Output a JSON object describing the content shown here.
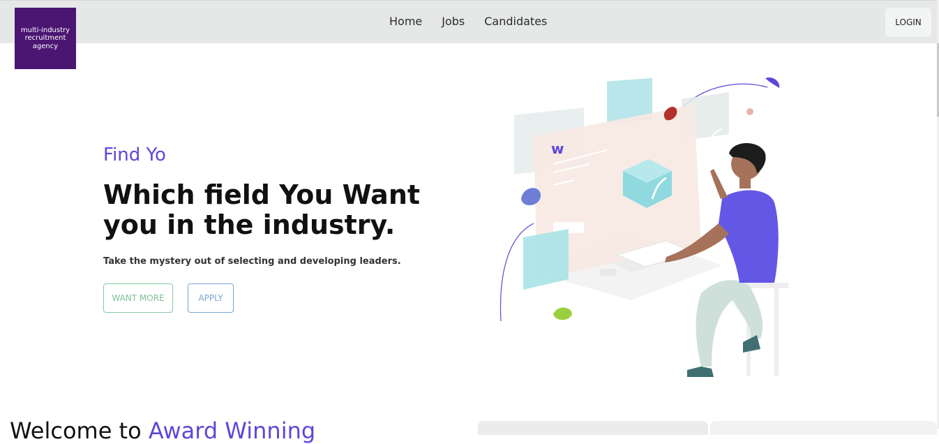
{
  "brand": {
    "logo_line1": "multi-industry",
    "logo_line2": "recruitment",
    "logo_line3": "agency"
  },
  "nav": {
    "items": [
      {
        "label": "Home"
      },
      {
        "label": "Jobs"
      },
      {
        "label": "Candidates"
      }
    ]
  },
  "header": {
    "login_label": "LOGIN"
  },
  "hero": {
    "eyebrow": "Find Yo",
    "headline": "Which field You Want you in the industry.",
    "subtext": "Take the mystery out of selecting and developing leaders.",
    "btn_more": "WANT MORE",
    "btn_apply": "APPLY"
  },
  "welcome": {
    "prefix": "Welcome to ",
    "accent": "Award Winning"
  },
  "colors": {
    "brand": "#4a1672",
    "accent": "#5b48d8",
    "topbar": "#e6e8e8"
  }
}
